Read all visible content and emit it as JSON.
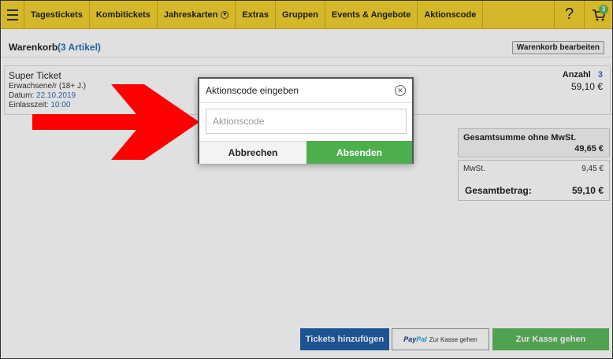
{
  "nav": {
    "items": [
      {
        "label": "Tagestickets"
      },
      {
        "label": "Kombitickets"
      },
      {
        "label": "Jahreskarten"
      },
      {
        "label": "Extras"
      },
      {
        "label": "Gruppen"
      },
      {
        "label": "Events & Angebote"
      },
      {
        "label": "Aktionscode"
      }
    ],
    "help_label": "?",
    "cart_badge": "3",
    "colors": {
      "bar": "#f2d230",
      "badge": "#5cb85c"
    }
  },
  "cart": {
    "title": "Warenkorb",
    "count": "(3 Artikel)",
    "edit_label": "Warenkorb bearbeiten"
  },
  "item": {
    "name": "Super Ticket",
    "category": "Erwachsene/r (18+ J.)",
    "date_label": "Datum:",
    "date_value": "22.10.2019",
    "time_label": "Einlasszeit:",
    "time_value": "10:00",
    "qty_label": "Anzahl",
    "qty_value": "3",
    "price": "59,10 €"
  },
  "summary": {
    "net_label": "Gesamtsumme ohne MwSt.",
    "net_value": "49,65 €",
    "vat_label": "MwSt.",
    "vat_value": "9,45 €",
    "total_label": "Gesamtbetrag:",
    "total_value": "59,10 €"
  },
  "actions": {
    "add_label": "Tickets hinzufügen",
    "paypal_brand_a": "Pay",
    "paypal_brand_b": "Pal",
    "paypal_label": "Zur Kasse gehen",
    "checkout_label": "Zur Kasse gehen"
  },
  "modal": {
    "title": "Aktionscode eingeben",
    "input_placeholder": "Aktionscode",
    "input_value": "",
    "cancel_label": "Abbrechen",
    "submit_label": "Absenden",
    "colors": {
      "submit": "#4cae4c",
      "arrow": "#ff0000"
    }
  }
}
